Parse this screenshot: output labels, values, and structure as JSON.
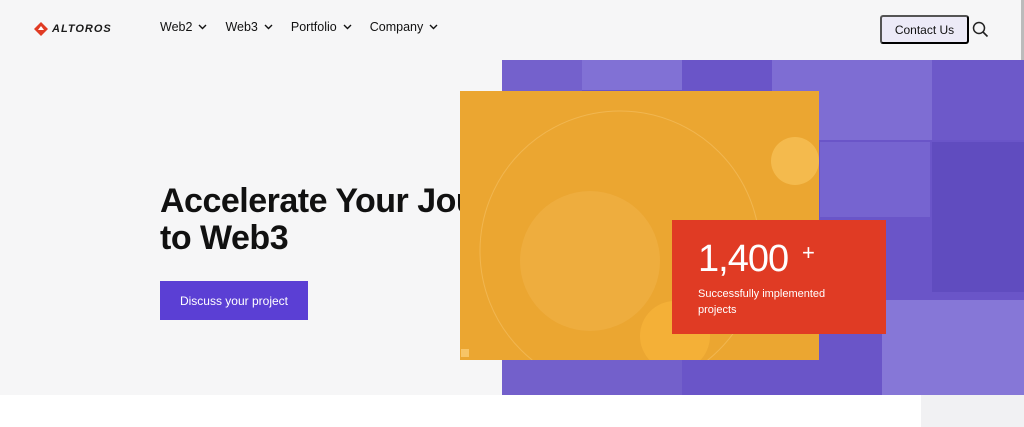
{
  "header": {
    "logo_text": "ALTOROS",
    "nav": [
      "Web2",
      "Web3",
      "Portfolio",
      "Company"
    ],
    "contact_label": "Contact Us"
  },
  "hero": {
    "title_line1": "Accelerate Your Journey",
    "title_line2": "to Web3",
    "cta_label": "Discuss your project",
    "stat_number": "1,400",
    "stat_plus": "+",
    "stat_label": "Successfully implemented projects"
  },
  "colors": {
    "brand_red": "#e03b24",
    "accent_purple": "#5b3fd4",
    "orange": "#eba631",
    "collage_purple": "#6a55c8"
  },
  "icons": [
    "altoros-logo-icon",
    "chevron-down-icon",
    "search-icon"
  ]
}
